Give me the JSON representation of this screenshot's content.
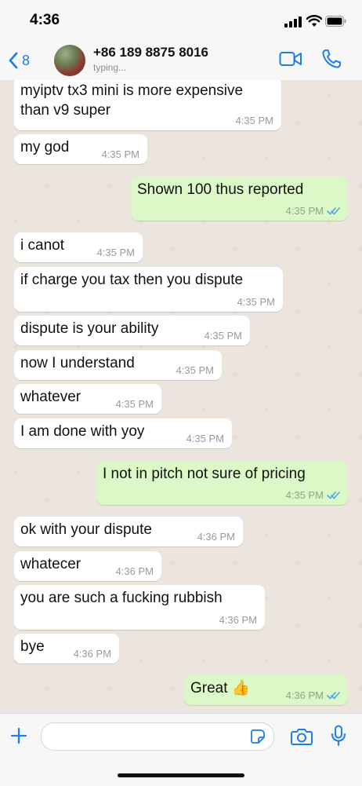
{
  "status_bar": {
    "time": "4:36"
  },
  "header": {
    "back_count": "8",
    "contact_name": "+86 189 8875 8016",
    "contact_status": "typing..."
  },
  "colors": {
    "accent": "#1e7ee8",
    "incoming_bubble": "#ffffff",
    "outgoing_bubble": "#dcf8c6",
    "read_ticks": "#4fa9e8"
  },
  "messages": [
    {
      "dir": "in",
      "lines": [
        "myiptv tx3 mini is more expensive",
        "than v9 super"
      ],
      "time": "4:35 PM"
    },
    {
      "dir": "in",
      "lines": [
        "my god"
      ],
      "time": "4:35 PM"
    },
    {
      "dir": "out",
      "lines": [
        "Shown 100 thus reported"
      ],
      "time": "4:35 PM",
      "read": true
    },
    {
      "dir": "in",
      "lines": [
        "i canot"
      ],
      "time": "4:35 PM"
    },
    {
      "dir": "in",
      "lines": [
        "if charge you tax then you dispute"
      ],
      "time": "4:35 PM"
    },
    {
      "dir": "in",
      "lines": [
        "dispute is your ability"
      ],
      "time": "4:35 PM"
    },
    {
      "dir": "in",
      "lines": [
        "now I understand"
      ],
      "time": "4:35 PM"
    },
    {
      "dir": "in",
      "lines": [
        "whatever"
      ],
      "time": "4:35 PM"
    },
    {
      "dir": "in",
      "lines": [
        "I am done with yoy"
      ],
      "time": "4:35 PM"
    },
    {
      "dir": "out",
      "lines": [
        "I not in pitch not sure of pricing"
      ],
      "time": "4:35 PM",
      "read": true
    },
    {
      "dir": "in",
      "lines": [
        "ok with your dispute"
      ],
      "time": "4:36 PM"
    },
    {
      "dir": "in",
      "lines": [
        "whatecer"
      ],
      "time": "4:36 PM"
    },
    {
      "dir": "in",
      "lines": [
        "you are such a fucking rubbish"
      ],
      "time": "4:36 PM"
    },
    {
      "dir": "in",
      "lines": [
        "bye"
      ],
      "time": "4:36 PM"
    },
    {
      "dir": "out",
      "lines": [
        "Great 👍"
      ],
      "time": "4:36 PM",
      "read": true
    }
  ],
  "input": {
    "placeholder": ""
  },
  "icons": [
    "signal-icon",
    "wifi-icon",
    "battery-icon",
    "back-chevron-icon",
    "video-call-icon",
    "phone-call-icon",
    "plus-icon",
    "sticker-icon",
    "camera-icon",
    "microphone-icon",
    "double-check-icon"
  ]
}
